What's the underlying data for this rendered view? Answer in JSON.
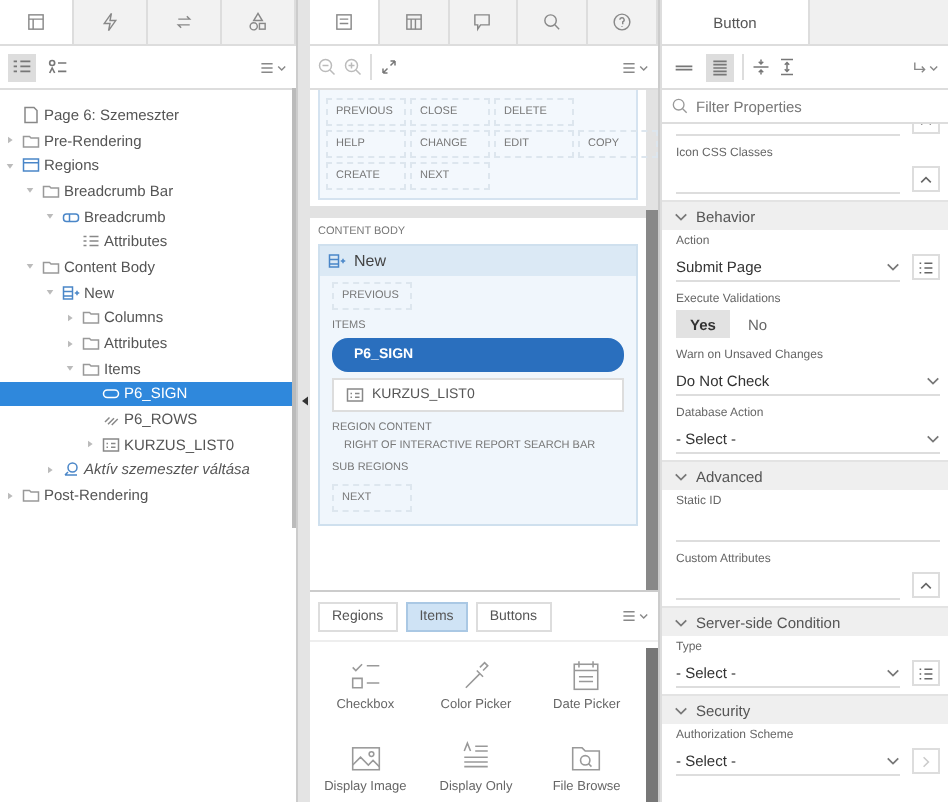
{
  "left_panel": {
    "tabs": [
      {
        "kind": "rendering",
        "selected": true
      },
      {
        "kind": "dynamic-actions",
        "selected": false
      },
      {
        "kind": "processing",
        "selected": false
      },
      {
        "kind": "shared-components",
        "selected": false
      }
    ],
    "view_modes": [
      {
        "kind": "numbered",
        "selected": true
      },
      {
        "kind": "sorted",
        "selected": false
      }
    ],
    "tree": [
      {
        "label": "Page 6: Szemeszter",
        "kind": "page",
        "selected": false
      },
      {
        "label": "Pre-Rendering",
        "kind": "folder",
        "expanded": false,
        "selected": false
      },
      {
        "label": "Regions",
        "kind": "regions",
        "expanded": true,
        "selected": false,
        "children": [
          {
            "label": "Breadcrumb Bar",
            "kind": "folder",
            "expanded": true,
            "selected": false,
            "children": [
              {
                "label": "Breadcrumb",
                "kind": "region",
                "expanded": true,
                "selected": false,
                "children": [
                  {
                    "label": "Attributes",
                    "kind": "attributes",
                    "selected": false
                  }
                ]
              }
            ]
          },
          {
            "label": "Content Body",
            "kind": "folder",
            "expanded": true,
            "selected": false,
            "children": [
              {
                "label": "New",
                "kind": "static-region",
                "expanded": true,
                "selected": false,
                "children": [
                  {
                    "label": "Columns",
                    "kind": "folder",
                    "expanded": false,
                    "selected": false
                  },
                  {
                    "label": "Attributes",
                    "kind": "folder",
                    "expanded": false,
                    "selected": false
                  },
                  {
                    "label": "Items",
                    "kind": "folder",
                    "expanded": true,
                    "selected": false,
                    "children": [
                      {
                        "label": "P6_SIGN",
                        "kind": "button-item",
                        "selected": true
                      },
                      {
                        "label": "P6_ROWS",
                        "kind": "link-item",
                        "selected": false
                      },
                      {
                        "label": "KURZUS_LIST0",
                        "kind": "list-item",
                        "expanded": false,
                        "selected": false
                      }
                    ]
                  }
                ]
              },
              {
                "label": "Aktív szemeszter váltása",
                "kind": "process",
                "expanded": false,
                "italic": true,
                "selected": false
              }
            ]
          }
        ]
      },
      {
        "label": "Post-Rendering",
        "kind": "folder",
        "expanded": false,
        "selected": false
      }
    ]
  },
  "layout_panel": {
    "tabs": [
      {
        "kind": "layout",
        "selected": true
      },
      {
        "kind": "component-view",
        "selected": false
      },
      {
        "kind": "messages",
        "selected": false
      },
      {
        "kind": "search",
        "selected": false
      },
      {
        "kind": "help",
        "selected": false
      }
    ],
    "top_region": {
      "button_rows": [
        [
          "PREVIOUS",
          "CLOSE",
          "DELETE"
        ],
        [
          "HELP",
          "CHANGE",
          "EDIT",
          "COPY"
        ],
        [
          "CREATE",
          "NEXT"
        ]
      ]
    },
    "content_body": {
      "label": "CONTENT BODY",
      "region": {
        "title": "New",
        "sections": [
          {
            "kind": "position",
            "label": "PREVIOUS"
          },
          {
            "kind": "items",
            "label": "ITEMS",
            "items": [
              {
                "label": "P6_SIGN",
                "kind": "button",
                "selected": true
              },
              {
                "label": "KURZUS_LIST0",
                "kind": "list",
                "selected": false
              }
            ]
          },
          {
            "kind": "content",
            "label": "REGION CONTENT",
            "text": "RIGHT OF INTERACTIVE REPORT SEARCH BAR"
          },
          {
            "kind": "label",
            "label": "SUB REGIONS"
          },
          {
            "kind": "position",
            "label": "NEXT"
          }
        ]
      }
    },
    "gallery": {
      "tabs": [
        {
          "label": "Regions",
          "selected": false
        },
        {
          "label": "Items",
          "selected": true
        },
        {
          "label": "Buttons",
          "selected": false
        }
      ],
      "items": [
        {
          "label": "Checkbox",
          "kind": "checkbox"
        },
        {
          "label": "Color Picker",
          "kind": "color-picker"
        },
        {
          "label": "Date Picker",
          "kind": "date-picker"
        },
        {
          "label": "Display Image",
          "kind": "display-image"
        },
        {
          "label": "Display Only",
          "kind": "display-only"
        },
        {
          "label": "File Browse",
          "kind": "file-browse"
        }
      ]
    }
  },
  "property_editor": {
    "tabs": [
      {
        "label": "Button",
        "selected": true
      }
    ],
    "view_modes": [
      {
        "kind": "compact",
        "selected": false
      },
      {
        "kind": "full",
        "selected": true
      }
    ],
    "filter": {
      "placeholder": "Filter Properties"
    },
    "properties": [
      {
        "kind": "text",
        "button": {
          "kind": "expand"
        }
      },
      {
        "kind": "text",
        "label": "Icon CSS Classes",
        "button": {
          "kind": "expand"
        }
      },
      {
        "kind": "section",
        "label": "Behavior",
        "expanded": true
      },
      {
        "kind": "select",
        "label": "Action",
        "value": "Submit Page",
        "button": {
          "kind": "list"
        }
      },
      {
        "kind": "toggle",
        "label": "Execute Validations",
        "options": [
          {
            "label": "Yes",
            "selected": true
          },
          {
            "label": "No",
            "selected": false
          }
        ]
      },
      {
        "kind": "select",
        "label": "Warn on Unsaved Changes",
        "value": "Do Not Check"
      },
      {
        "kind": "select",
        "label": "Database Action",
        "value": "- Select -"
      },
      {
        "kind": "section",
        "label": "Advanced",
        "expanded": true
      },
      {
        "kind": "text",
        "label": "Static ID"
      },
      {
        "kind": "text",
        "label": "Custom Attributes",
        "button": {
          "kind": "expand"
        }
      },
      {
        "kind": "section",
        "label": "Server-side Condition",
        "expanded": true
      },
      {
        "kind": "select",
        "label": "Type",
        "value": "- Select -",
        "button": {
          "kind": "list"
        }
      },
      {
        "kind": "section",
        "label": "Security",
        "expanded": true
      },
      {
        "kind": "select",
        "label": "Authorization Scheme",
        "value": "- Select -",
        "button": {
          "kind": "go"
        }
      }
    ]
  }
}
